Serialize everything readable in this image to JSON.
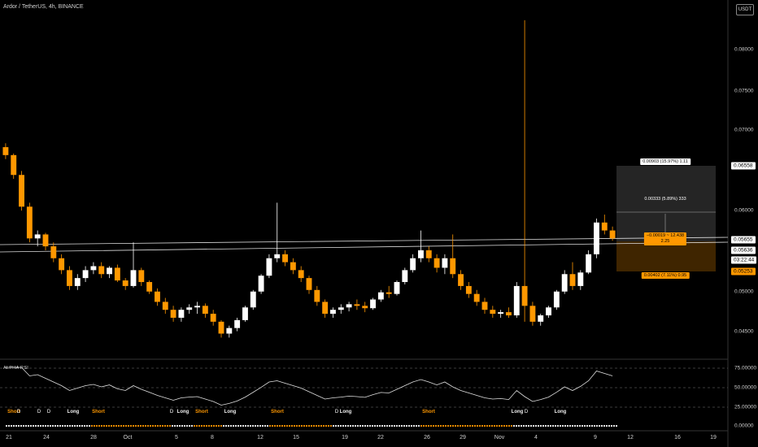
{
  "header": {
    "title": "Ardor / TetherUS, 4h, BINANCE",
    "currency": "USDT"
  },
  "price_axis": {
    "ticks": [
      "0.08000",
      "0.07500",
      "0.07000",
      "0.06000",
      "0.05000",
      "0.04500"
    ],
    "boxes": [
      {
        "label": "0.06558",
        "bg": "#ffffff",
        "fg": "#000000"
      },
      {
        "label": "0.05655",
        "bg": "#ffffff",
        "fg": "#000000"
      },
      {
        "label": "0.05636",
        "bg": "#ffffff",
        "fg": "#000000"
      },
      {
        "label": "03:22:44",
        "bg": "#ffffff",
        "fg": "#000000"
      },
      {
        "label": "0.05253",
        "bg": "#ff9800",
        "fg": "#000000"
      }
    ]
  },
  "time_axis": [
    "21",
    "24",
    "28",
    "Oct",
    "5",
    "8",
    "12",
    "15",
    "19",
    "22",
    "26",
    "29",
    "Nov",
    "4",
    "9",
    "12",
    "16",
    "19"
  ],
  "position_tool": {
    "target_label": "0.00903 (15.97%) 1.11",
    "mid_label": "0.00333 (5.89%) 333",
    "entry_label": "−0.00019 ~ 12.438",
    "entry_label2": "2.25",
    "stop_label": "0.00402 (7.11%) 0.95"
  },
  "indicator": {
    "title": "ALPHA RSI",
    "levels": [
      "75.00000",
      "50.00000",
      "25.00000",
      "0.00000"
    ],
    "signals": [
      {
        "text": "Short",
        "color": "orange"
      },
      {
        "text": "Long",
        "color": "white"
      },
      {
        "text": "Short",
        "color": "orange"
      },
      {
        "text": "Long",
        "color": "white"
      },
      {
        "text": "Short",
        "color": "orange"
      },
      {
        "text": "Long",
        "color": "white"
      },
      {
        "text": "Short",
        "color": "orange"
      },
      {
        "text": "Long",
        "color": "white"
      },
      {
        "text": "Short",
        "color": "orange"
      },
      {
        "text": "Long",
        "color": "white"
      },
      {
        "text": "Long",
        "color": "white"
      }
    ],
    "markers": [
      "D",
      "D",
      "D",
      "D",
      "D",
      "D"
    ]
  },
  "colors": {
    "bull": "#ffffff",
    "bear": "#ff9800",
    "grid": "#555555",
    "channel": "#dddddd"
  },
  "chart_data": {
    "type": "candlestick",
    "ylim": [
      0.0425,
      0.0845
    ],
    "ohlc": [
      [
        0.068,
        0.0685,
        0.0665,
        0.067
      ],
      [
        0.067,
        0.0672,
        0.064,
        0.0645
      ],
      [
        0.0645,
        0.065,
        0.06,
        0.0605
      ],
      [
        0.0605,
        0.061,
        0.056,
        0.0565
      ],
      [
        0.0565,
        0.0575,
        0.0555,
        0.057
      ],
      [
        0.057,
        0.0572,
        0.055,
        0.0555
      ],
      [
        0.0555,
        0.056,
        0.0535,
        0.054
      ],
      [
        0.054,
        0.0545,
        0.052,
        0.0525
      ],
      [
        0.0525,
        0.053,
        0.05,
        0.0505
      ],
      [
        0.0505,
        0.052,
        0.05,
        0.0515
      ],
      [
        0.0515,
        0.053,
        0.051,
        0.0525
      ],
      [
        0.0525,
        0.0535,
        0.052,
        0.053
      ],
      [
        0.053,
        0.0535,
        0.0515,
        0.052
      ],
      [
        0.052,
        0.053,
        0.0515,
        0.0528
      ],
      [
        0.0528,
        0.0532,
        0.051,
        0.0512
      ],
      [
        0.0512,
        0.0515,
        0.05,
        0.0505
      ],
      [
        0.0505,
        0.056,
        0.0503,
        0.0525
      ],
      [
        0.0525,
        0.0528,
        0.0505,
        0.051
      ],
      [
        0.051,
        0.0512,
        0.0495,
        0.0498
      ],
      [
        0.0498,
        0.0502,
        0.048,
        0.0485
      ],
      [
        0.0485,
        0.049,
        0.047,
        0.0475
      ],
      [
        0.0475,
        0.048,
        0.046,
        0.0465
      ],
      [
        0.0465,
        0.0478,
        0.046,
        0.0475
      ],
      [
        0.0475,
        0.0482,
        0.047,
        0.0478
      ],
      [
        0.0478,
        0.0485,
        0.047,
        0.048
      ],
      [
        0.048,
        0.0483,
        0.0465,
        0.047
      ],
      [
        0.047,
        0.0475,
        0.0455,
        0.046
      ],
      [
        0.046,
        0.0462,
        0.044,
        0.0445
      ],
      [
        0.0445,
        0.0455,
        0.044,
        0.0452
      ],
      [
        0.0452,
        0.0465,
        0.0448,
        0.0462
      ],
      [
        0.0462,
        0.048,
        0.046,
        0.0478
      ],
      [
        0.0478,
        0.05,
        0.0475,
        0.0498
      ],
      [
        0.0498,
        0.052,
        0.0495,
        0.0518
      ],
      [
        0.0518,
        0.0545,
        0.0515,
        0.054
      ],
      [
        0.054,
        0.061,
        0.0535,
        0.0545
      ],
      [
        0.0545,
        0.055,
        0.053,
        0.0535
      ],
      [
        0.0535,
        0.054,
        0.052,
        0.0525
      ],
      [
        0.0525,
        0.053,
        0.051,
        0.0515
      ],
      [
        0.0515,
        0.0518,
        0.0495,
        0.05
      ],
      [
        0.05,
        0.0505,
        0.048,
        0.0485
      ],
      [
        0.0485,
        0.0488,
        0.0465,
        0.047
      ],
      [
        0.047,
        0.0478,
        0.0465,
        0.0475
      ],
      [
        0.0475,
        0.0482,
        0.047,
        0.0478
      ],
      [
        0.0478,
        0.0485,
        0.0473,
        0.0482
      ],
      [
        0.0482,
        0.0488,
        0.0475,
        0.048
      ],
      [
        0.048,
        0.0485,
        0.0472,
        0.0477
      ],
      [
        0.0477,
        0.049,
        0.0475,
        0.0488
      ],
      [
        0.0488,
        0.05,
        0.0485,
        0.0497
      ],
      [
        0.0497,
        0.0505,
        0.049,
        0.0495
      ],
      [
        0.0495,
        0.0512,
        0.0493,
        0.051
      ],
      [
        0.051,
        0.0528,
        0.0507,
        0.0525
      ],
      [
        0.0525,
        0.0545,
        0.0522,
        0.054
      ],
      [
        0.054,
        0.0575,
        0.0535,
        0.055
      ],
      [
        0.055,
        0.0555,
        0.0535,
        0.054
      ],
      [
        0.054,
        0.0545,
        0.0522,
        0.0528
      ],
      [
        0.0528,
        0.0545,
        0.052,
        0.054
      ],
      [
        0.054,
        0.057,
        0.0515,
        0.052
      ],
      [
        0.052,
        0.0525,
        0.05,
        0.0505
      ],
      [
        0.0505,
        0.051,
        0.049,
        0.0495
      ],
      [
        0.0495,
        0.05,
        0.048,
        0.0485
      ],
      [
        0.0485,
        0.049,
        0.047,
        0.0475
      ],
      [
        0.0475,
        0.048,
        0.0465,
        0.047
      ],
      [
        0.047,
        0.0475,
        0.0465,
        0.0472
      ],
      [
        0.0472,
        0.0478,
        0.0465,
        0.0468
      ],
      [
        0.0468,
        0.051,
        0.0465,
        0.0505
      ],
      [
        0.0505,
        0.084,
        0.046,
        0.048
      ],
      [
        0.048,
        0.0485,
        0.0455,
        0.046
      ],
      [
        0.046,
        0.047,
        0.0455,
        0.0468
      ],
      [
        0.0468,
        0.048,
        0.0465,
        0.0478
      ],
      [
        0.0478,
        0.05,
        0.0475,
        0.0498
      ],
      [
        0.0498,
        0.0525,
        0.0495,
        0.052
      ],
      [
        0.052,
        0.0535,
        0.05,
        0.0505
      ],
      [
        0.0505,
        0.0525,
        0.05,
        0.0522
      ],
      [
        0.0522,
        0.055,
        0.052,
        0.0545
      ],
      [
        0.0545,
        0.059,
        0.054,
        0.0585
      ],
      [
        0.0585,
        0.0595,
        0.057,
        0.0575
      ],
      [
        0.0575,
        0.058,
        0.0562,
        0.0565
      ]
    ]
  }
}
